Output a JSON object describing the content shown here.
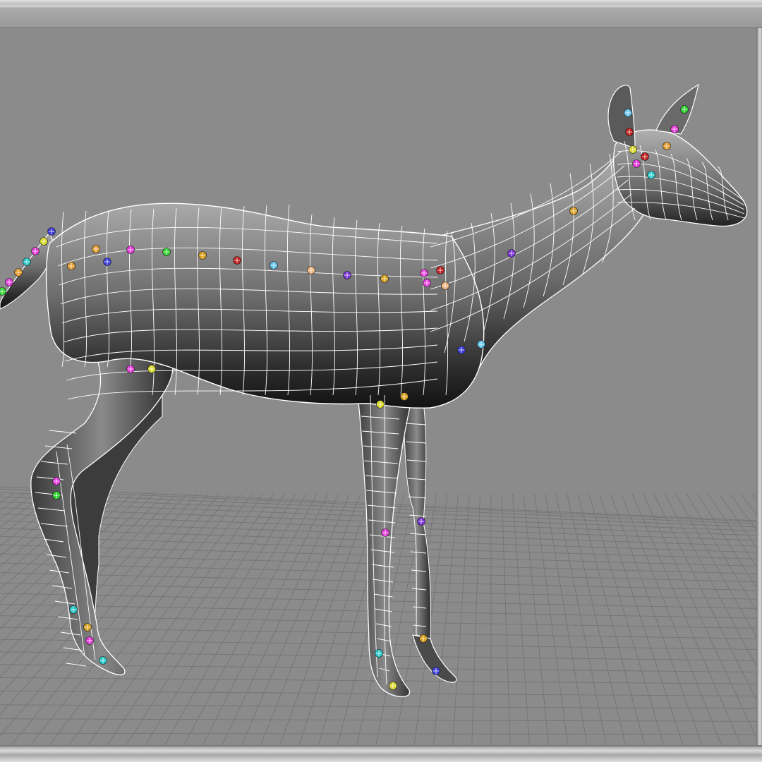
{
  "viewport": {
    "background_color": "#8b8b8b",
    "grid_line_color": "#767676",
    "wireframe_color": "#ffffff",
    "model": "deer-mesh"
  },
  "joint_colors": [
    "#2fd12f",
    "#e43ad9",
    "#e39a2a",
    "#26c7c7",
    "#3b3bd8",
    "#d8d82a",
    "#c01a1a",
    "#7a2fd6",
    "#e8b07a",
    "#d8a020",
    "#5fc0e8"
  ]
}
